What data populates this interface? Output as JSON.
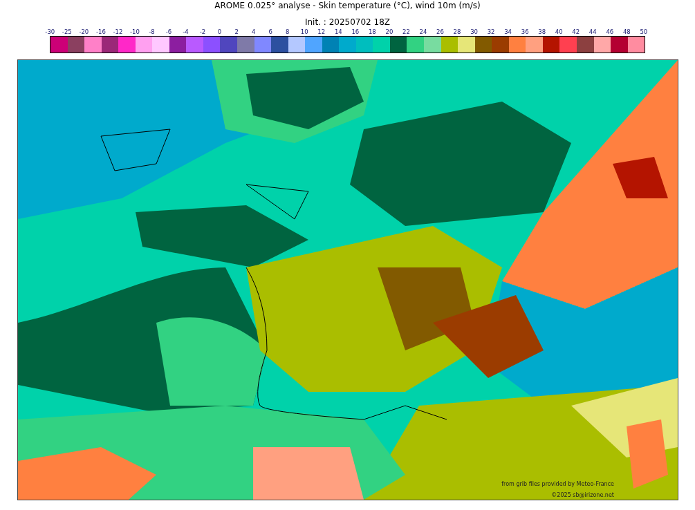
{
  "title": "AROME 0.025° analyse - Skin temperature (°C), wind 10m (m/s)",
  "subtitle": "Init. : 20250702 18Z",
  "colorbar": {
    "ticks": [
      "-30",
      "-25",
      "-20",
      "-16",
      "-12",
      "-10",
      "-8",
      "-6",
      "-4",
      "-2",
      "0",
      "2",
      "4",
      "6",
      "8",
      "10",
      "12",
      "14",
      "16",
      "18",
      "20",
      "22",
      "24",
      "26",
      "28",
      "30",
      "32",
      "34",
      "36",
      "38",
      "40",
      "42",
      "44",
      "46",
      "48",
      "50"
    ],
    "bins": [
      {
        "color": "#cc0077"
      },
      {
        "color": "#8b4060"
      },
      {
        "color": "#ff80c8"
      },
      {
        "color": "#9b2878"
      },
      {
        "color": "#ff28c8"
      },
      {
        "color": "#ffa0f0"
      },
      {
        "color": "#ffc8ff"
      },
      {
        "color": "#8c1ea0"
      },
      {
        "color": "#b95aff"
      },
      {
        "color": "#8c50ff"
      },
      {
        "color": "#5046be"
      },
      {
        "color": "#7f7aa8"
      },
      {
        "color": "#8088ff"
      },
      {
        "color": "#2d50a0"
      },
      {
        "color": "#b4c8ff"
      },
      {
        "color": "#50a5ff"
      },
      {
        "color": "#0082b4"
      },
      {
        "color": "#00aacc"
      },
      {
        "color": "#00bebe"
      },
      {
        "color": "#00d2aa"
      },
      {
        "color": "#006440"
      },
      {
        "color": "#32d282"
      },
      {
        "color": "#78dca0"
      },
      {
        "color": "#aabe00"
      },
      {
        "color": "#e6e678"
      },
      {
        "color": "#825a00"
      },
      {
        "color": "#9b3c00"
      },
      {
        "color": "#ff8040"
      },
      {
        "color": "#ffa080"
      },
      {
        "color": "#b41400"
      },
      {
        "color": "#ff4050"
      },
      {
        "color": "#8c4040"
      },
      {
        "color": "#ffa8a8"
      },
      {
        "color": "#b40032"
      },
      {
        "color": "#ff8ca0"
      }
    ]
  },
  "credits": [
    "from grib files provided by Meteo-France",
    "©2025 sb@irizone.net"
  ]
}
